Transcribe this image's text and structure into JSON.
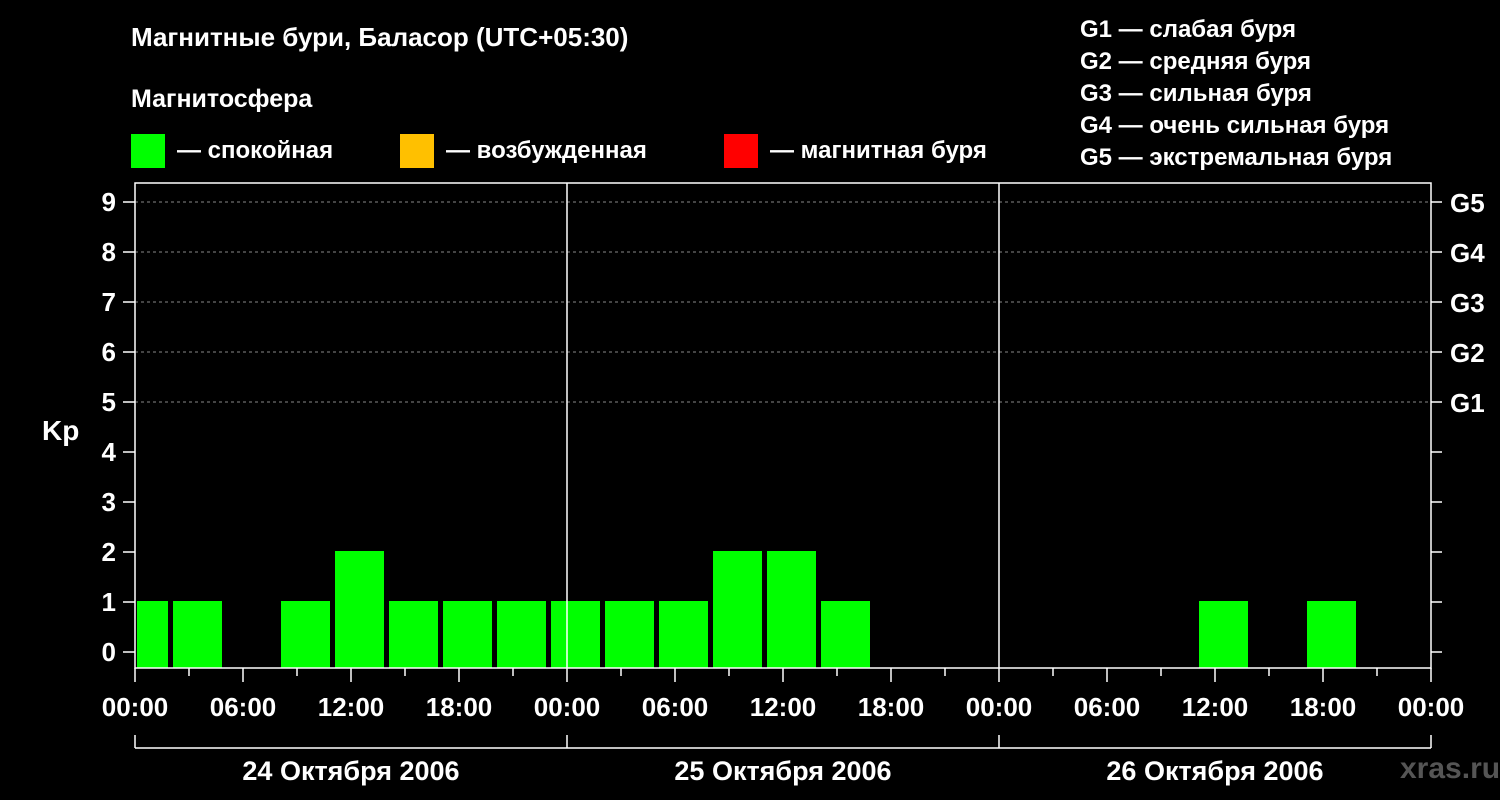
{
  "chart_data": {
    "type": "bar",
    "title": "Магнитные бури, Баласор (UTC+05:30)",
    "subtitle": "Магнитосфера",
    "ylabel": "Kp",
    "ylim": [
      0,
      9
    ],
    "yticks": [
      "0",
      "1",
      "2",
      "3",
      "4",
      "5",
      "6",
      "7",
      "8",
      "9"
    ],
    "right_ticks": [
      {
        "value": 5,
        "label": "G1"
      },
      {
        "value": 6,
        "label": "G2"
      },
      {
        "value": 7,
        "label": "G3"
      },
      {
        "value": 8,
        "label": "G4"
      },
      {
        "value": 9,
        "label": "G5"
      }
    ],
    "xticks": [
      "00:00",
      "06:00",
      "12:00",
      "18:00",
      "00:00",
      "06:00",
      "12:00",
      "18:00",
      "00:00",
      "06:00",
      "12:00",
      "18:00",
      "00:00"
    ],
    "days": [
      "24 Октября 2006",
      "25 Октября 2006",
      "26 Октября 2006"
    ],
    "legend": [
      {
        "label": "— спокойная",
        "color": "#00ff00"
      },
      {
        "label": "— возбужденная",
        "color": "#ffc000"
      },
      {
        "label": "— магнитная буря",
        "color": "#ff0000"
      }
    ],
    "storm_legend": [
      "G1 — слабая буря",
      "G2 — средняя буря",
      "G3 — сильная буря",
      "G4 — очень сильная буря",
      "G5 — экстремальная буря"
    ],
    "grid": "dashed, Kp 5–9",
    "bar_color": "#00ff00",
    "bars": [
      {
        "start_hour": 0,
        "end_hour": 2,
        "kp": 1
      },
      {
        "start_hour": 2,
        "end_hour": 5,
        "kp": 1
      },
      {
        "start_hour": 8,
        "end_hour": 11,
        "kp": 1
      },
      {
        "start_hour": 11,
        "end_hour": 14,
        "kp": 2
      },
      {
        "start_hour": 14,
        "end_hour": 17,
        "kp": 1
      },
      {
        "start_hour": 17,
        "end_hour": 20,
        "kp": 1
      },
      {
        "start_hour": 20,
        "end_hour": 23,
        "kp": 1
      },
      {
        "start_hour": 23,
        "end_hour": 26,
        "kp": 1
      },
      {
        "start_hour": 26,
        "end_hour": 29,
        "kp": 1
      },
      {
        "start_hour": 29,
        "end_hour": 32,
        "kp": 1
      },
      {
        "start_hour": 32,
        "end_hour": 35,
        "kp": 2
      },
      {
        "start_hour": 35,
        "end_hour": 38,
        "kp": 2
      },
      {
        "start_hour": 38,
        "end_hour": 41,
        "kp": 1
      },
      {
        "start_hour": 59,
        "end_hour": 62,
        "kp": 1
      },
      {
        "start_hour": 65,
        "end_hour": 68,
        "kp": 1
      }
    ]
  },
  "watermark": "xras.ru"
}
